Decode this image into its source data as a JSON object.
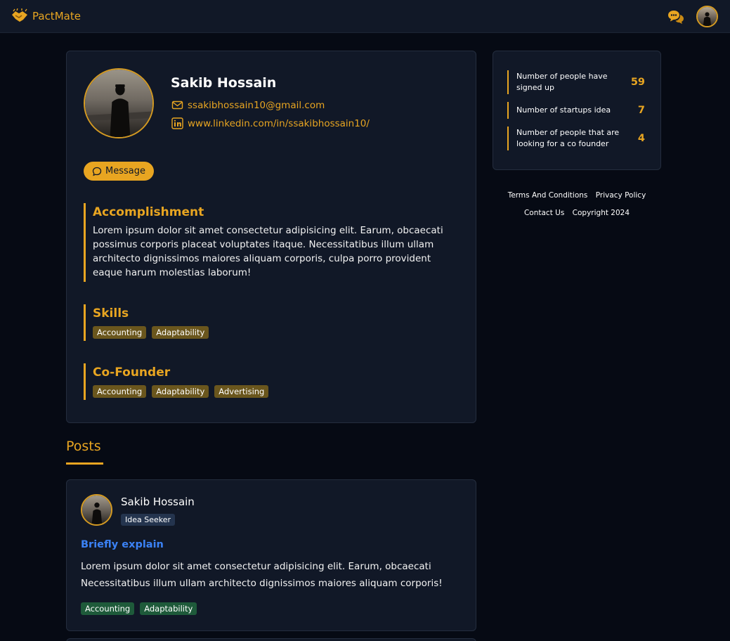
{
  "navbar": {
    "brand": "PactMate",
    "brand_icon": "handshake-icon",
    "chat_icon": "chat-bubbles-icon",
    "accent": "#e8a521"
  },
  "profile": {
    "name": "Sakib Hossain",
    "email": "ssakibhossain10@gmail.com",
    "linkedin": "www.linkedin.com/in/ssakibhossain10/",
    "message_label": "Message",
    "accomplishment": {
      "title": "Accomplishment",
      "body": "Lorem ipsum dolor sit amet consectetur adipisicing elit. Earum, obcaecati possimus corporis placeat voluptates itaque. Necessitatibus illum ullam architecto dignissimos maiores aliquam corporis, culpa porro provident eaque harum molestias laborum!"
    },
    "skills": {
      "title": "Skills",
      "tags": [
        "Accounting",
        "Adaptability"
      ]
    },
    "cofounder": {
      "title": "Co-Founder",
      "tags": [
        "Accounting",
        "Adaptability",
        "Advertising"
      ]
    }
  },
  "stats": [
    {
      "label": "Number of people have signed up",
      "value": "59"
    },
    {
      "label": "Number of startups idea",
      "value": "7"
    },
    {
      "label": "Number of people that are looking for a co founder",
      "value": "4"
    }
  ],
  "footer": {
    "terms": "Terms And Conditions",
    "privacy": "Privacy Policy",
    "contact": "Contact Us",
    "copyright": "Copyright 2024"
  },
  "posts": {
    "heading": "Posts",
    "items": [
      {
        "author": "Sakib Hossain",
        "role": "Idea Seeker",
        "title": "Briefly explain",
        "body": "Lorem ipsum dolor sit amet consectetur adipisicing elit. Earum, obcaecati Necessitatibus illum ullam architecto dignissimos maiores aliquam corporis!",
        "tags": [
          "Accounting",
          "Adaptability"
        ]
      }
    ]
  }
}
